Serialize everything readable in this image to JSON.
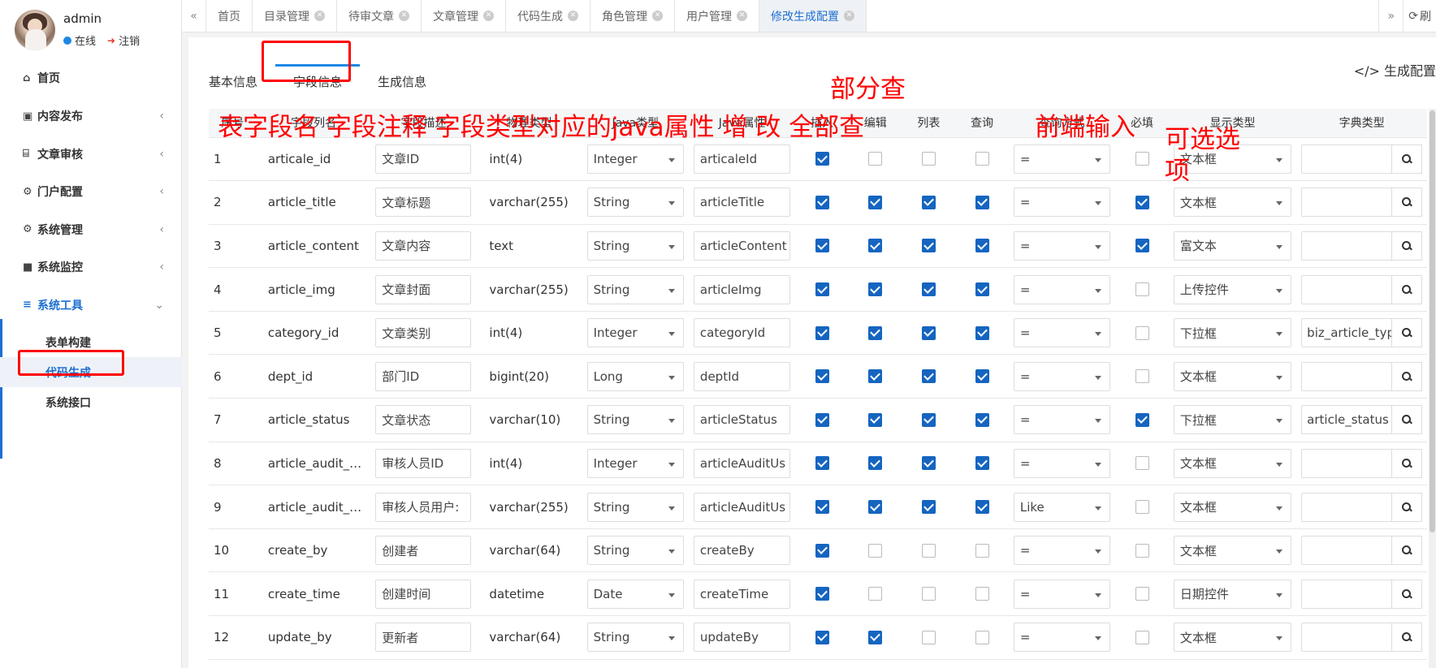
{
  "user": {
    "name": "admin",
    "status": "在线",
    "logout": "注销"
  },
  "sidebar": {
    "items": [
      {
        "icon": "home-icon",
        "label": "首页",
        "expandable": false
      },
      {
        "icon": "briefcase-icon",
        "label": "内容发布",
        "expandable": true
      },
      {
        "icon": "bank-icon",
        "label": "文章审核",
        "expandable": true
      },
      {
        "icon": "gear-icon",
        "label": "门户配置",
        "expandable": true
      },
      {
        "icon": "gear-icon",
        "label": "系统管理",
        "expandable": true
      },
      {
        "icon": "video-icon",
        "label": "系统监控",
        "expandable": true
      },
      {
        "icon": "bars-icon",
        "label": "系统工具",
        "expandable": true
      }
    ],
    "submenu": [
      "表单构建",
      "代码生成",
      "系统接口"
    ]
  },
  "tabs": {
    "items": [
      "首页",
      "目录管理",
      "待审文章",
      "文章管理",
      "代码生成",
      "角色管理",
      "用户管理",
      "修改生成配置"
    ],
    "refresh": "刷"
  },
  "form_tabs": [
    "基本信息",
    "字段信息",
    "生成信息"
  ],
  "gen_config_label": "</> 生成配置",
  "table": {
    "headers": [
      "序号",
      "字段列名",
      "字段描述",
      "物理类型",
      "Java类型",
      "Java属性",
      "插入",
      "编辑",
      "列表",
      "查询",
      "查询方式",
      "必填",
      "显示类型",
      "字典类型"
    ],
    "rows": [
      {
        "no": "1",
        "col": "articale_id",
        "desc": "文章ID",
        "phys": "int(4)",
        "jtype": "Integer",
        "jprop": "articaleId",
        "ins": true,
        "edit": false,
        "list": false,
        "query": false,
        "qmode": "=",
        "req": false,
        "disp": "文本框",
        "dict": ""
      },
      {
        "no": "2",
        "col": "article_title",
        "desc": "文章标题",
        "phys": "varchar(255)",
        "jtype": "String",
        "jprop": "articleTitle",
        "ins": true,
        "edit": true,
        "list": true,
        "query": true,
        "qmode": "=",
        "req": true,
        "disp": "文本框",
        "dict": ""
      },
      {
        "no": "3",
        "col": "article_content",
        "desc": "文章内容",
        "phys": "text",
        "jtype": "String",
        "jprop": "articleContent",
        "ins": true,
        "edit": true,
        "list": true,
        "query": true,
        "qmode": "=",
        "req": true,
        "disp": "富文本",
        "dict": ""
      },
      {
        "no": "4",
        "col": "article_img",
        "desc": "文章封面",
        "phys": "varchar(255)",
        "jtype": "String",
        "jprop": "articleImg",
        "ins": true,
        "edit": true,
        "list": true,
        "query": true,
        "qmode": "=",
        "req": false,
        "disp": "上传控件",
        "dict": ""
      },
      {
        "no": "5",
        "col": "category_id",
        "desc": "文章类别",
        "phys": "int(4)",
        "jtype": "Integer",
        "jprop": "categoryId",
        "ins": true,
        "edit": true,
        "list": true,
        "query": true,
        "qmode": "=",
        "req": false,
        "disp": "下拉框",
        "dict": "biz_article_typ"
      },
      {
        "no": "6",
        "col": "dept_id",
        "desc": "部门ID",
        "phys": "bigint(20)",
        "jtype": "Long",
        "jprop": "deptId",
        "ins": true,
        "edit": true,
        "list": true,
        "query": true,
        "qmode": "=",
        "req": false,
        "disp": "文本框",
        "dict": ""
      },
      {
        "no": "7",
        "col": "article_status",
        "desc": "文章状态",
        "phys": "varchar(10)",
        "jtype": "String",
        "jprop": "articleStatus",
        "ins": true,
        "edit": true,
        "list": true,
        "query": true,
        "qmode": "=",
        "req": true,
        "disp": "下拉框",
        "dict": "article_status"
      },
      {
        "no": "8",
        "col": "article_audit_…",
        "desc": "审核人员ID",
        "phys": "int(4)",
        "jtype": "Integer",
        "jprop": "articleAuditUs",
        "ins": true,
        "edit": true,
        "list": true,
        "query": true,
        "qmode": "=",
        "req": false,
        "disp": "文本框",
        "dict": ""
      },
      {
        "no": "9",
        "col": "article_audit_…",
        "desc": "审核人员用户:",
        "phys": "varchar(255)",
        "jtype": "String",
        "jprop": "articleAuditUs",
        "ins": true,
        "edit": true,
        "list": true,
        "query": true,
        "qmode": "Like",
        "req": false,
        "disp": "文本框",
        "dict": ""
      },
      {
        "no": "10",
        "col": "create_by",
        "desc": "创建者",
        "phys": "varchar(64)",
        "jtype": "String",
        "jprop": "createBy",
        "ins": true,
        "edit": false,
        "list": false,
        "query": false,
        "qmode": "=",
        "req": false,
        "disp": "文本框",
        "dict": ""
      },
      {
        "no": "11",
        "col": "create_time",
        "desc": "创建时间",
        "phys": "datetime",
        "jtype": "Date",
        "jprop": "createTime",
        "ins": true,
        "edit": false,
        "list": false,
        "query": false,
        "qmode": "=",
        "req": false,
        "disp": "日期控件",
        "dict": ""
      },
      {
        "no": "12",
        "col": "update_by",
        "desc": "更新者",
        "phys": "varchar(64)",
        "jtype": "String",
        "jprop": "updateBy",
        "ins": true,
        "edit": true,
        "list": false,
        "query": false,
        "qmode": "=",
        "req": false,
        "disp": "文本框",
        "dict": ""
      }
    ]
  },
  "annotations": {
    "line1": "表字段名 字段注释 字段类型对应的java属性 增  改 全部查",
    "partial_query": "部分查",
    "frontend_input": "前端输入",
    "optional": "可选选",
    "optional2": "项"
  }
}
